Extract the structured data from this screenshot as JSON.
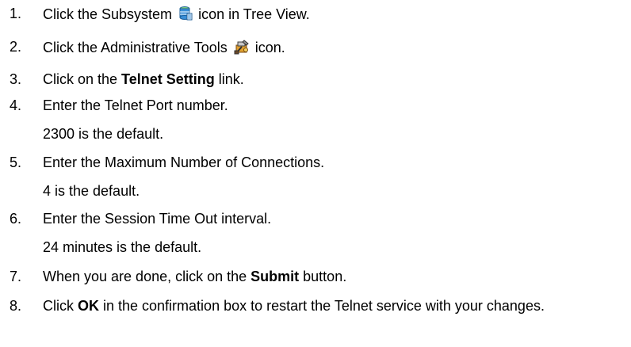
{
  "steps": [
    {
      "number": "1.",
      "before": "Click the Subsystem ",
      "icon": "subsystem-icon",
      "after": " icon in Tree View."
    },
    {
      "number": "2.",
      "before": "Click the Administrative Tools ",
      "icon": "administrative-tools-icon",
      "after": " icon."
    },
    {
      "number": "3.",
      "before": "Click on the ",
      "bold": "Telnet Setting",
      "after": " link."
    },
    {
      "number": "4.",
      "text": "Enter the Telnet Port number.",
      "note": "2300 is the default."
    },
    {
      "number": "5.",
      "text": "Enter the Maximum Number of Connections.",
      "note": "4 is the default."
    },
    {
      "number": "6.",
      "text": "Enter the Session Time Out interval.",
      "note": "24 minutes is the default."
    },
    {
      "number": "7.",
      "before": "When you are done, click on the ",
      "bold": "Submit",
      "after": " button."
    },
    {
      "number": "8.",
      "before": "Click ",
      "bold": "OK",
      "after": " in the confirmation box to restart the Telnet service with your changes."
    }
  ]
}
